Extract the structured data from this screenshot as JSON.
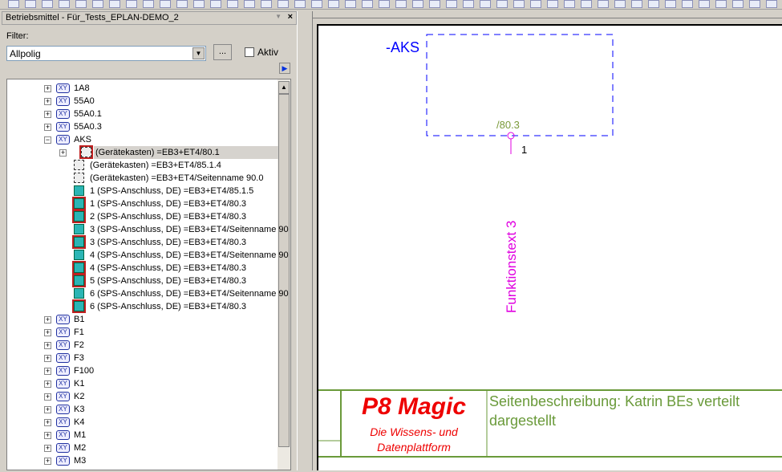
{
  "panel": {
    "title": "Betriebsmittel - Für_Tests_EPLAN-DEMO_2",
    "close": "×",
    "filter_label": "Filter:",
    "filter_value": "Allpolig",
    "dots_label": "...",
    "aktiv_label": "Aktiv"
  },
  "tree": {
    "top": [
      {
        "label": "1A8"
      },
      {
        "label": "55A0"
      },
      {
        "label": "55A0.1"
      },
      {
        "label": "55A0.3"
      },
      {
        "label": "AKS"
      }
    ],
    "children": [
      {
        "label": "(Gerätekasten) =EB3+ET4/80.1",
        "icon": "box",
        "red": true,
        "selected": true,
        "expander": true
      },
      {
        "label": "(Gerätekasten) =EB3+ET4/85.1.4",
        "icon": "box"
      },
      {
        "label": "(Gerätekasten) =EB3+ET4/Seitenname 90.0",
        "icon": "box"
      },
      {
        "label": "1 (SPS-Anschluss, DE) =EB3+ET4/85.1.5",
        "icon": "cube"
      },
      {
        "label": "1 (SPS-Anschluss, DE) =EB3+ET4/80.3",
        "icon": "cube",
        "red": true
      },
      {
        "label": "2 (SPS-Anschluss, DE) =EB3+ET4/80.3",
        "icon": "cube",
        "red": true
      },
      {
        "label": "3 (SPS-Anschluss, DE) =EB3+ET4/Seitenname 90",
        "icon": "cube"
      },
      {
        "label": "3 (SPS-Anschluss, DE) =EB3+ET4/80.3",
        "icon": "cube",
        "red": true
      },
      {
        "label": "4 (SPS-Anschluss, DE) =EB3+ET4/Seitenname 90",
        "icon": "cube"
      },
      {
        "label": "4 (SPS-Anschluss, DE) =EB3+ET4/80.3",
        "icon": "cube",
        "red": true
      },
      {
        "label": "5 (SPS-Anschluss, DE) =EB3+ET4/80.3",
        "icon": "cube",
        "red": true
      },
      {
        "label": "6 (SPS-Anschluss, DE) =EB3+ET4/Seitenname 90",
        "icon": "cube"
      },
      {
        "label": "6 (SPS-Anschluss, DE) =EB3+ET4/80.3",
        "icon": "cube",
        "red": true
      }
    ],
    "bottom": [
      {
        "label": "B1"
      },
      {
        "label": "F1"
      },
      {
        "label": "F2"
      },
      {
        "label": "F3"
      },
      {
        "label": "F100"
      },
      {
        "label": "K1"
      },
      {
        "label": "K2"
      },
      {
        "label": "K3"
      },
      {
        "label": "K4"
      },
      {
        "label": "M1"
      },
      {
        "label": "M2"
      },
      {
        "label": "M3"
      }
    ],
    "xy_badge": "XY"
  },
  "drawing": {
    "device_tag": "-AKS",
    "cross_ref": "/80.3",
    "pin": "1",
    "function_text": "Funktionstext 3",
    "title_block": {
      "logo_title": "P8 Magic",
      "logo_sub1": "Die Wissens- und",
      "logo_sub2": "Datenplattform",
      "description": "Seitenbeschreibung: Katrin BEs verteilt dargestellt"
    }
  },
  "colors": {
    "tag": "#0000ff",
    "magenta": "#e000e0",
    "green": "#6a9a3a",
    "logo": "#ee0000"
  }
}
